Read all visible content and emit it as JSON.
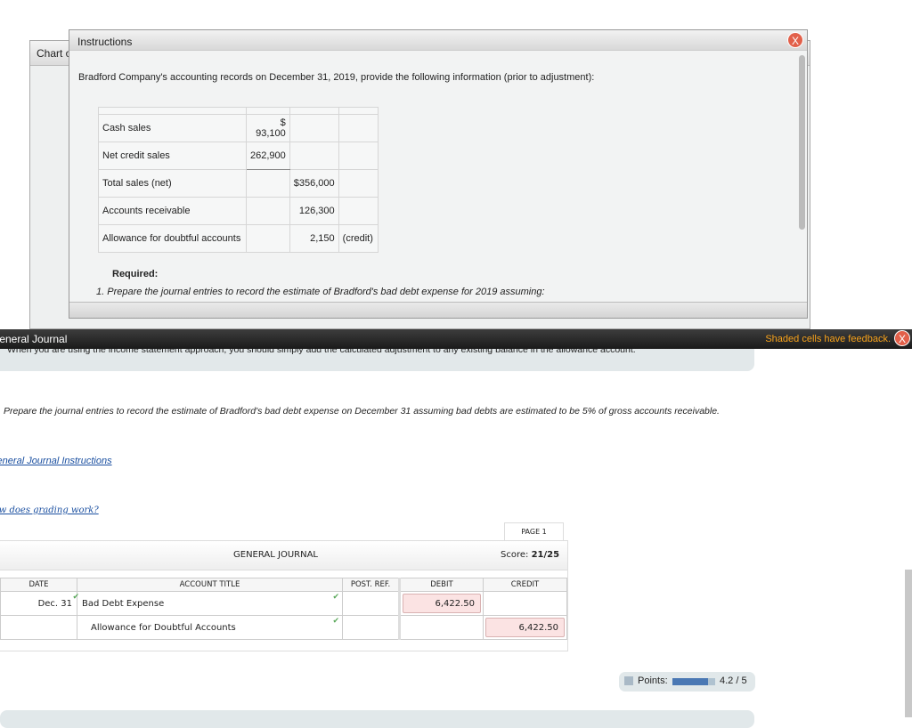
{
  "chart_window": {
    "title": "Chart of Accounts (partial)"
  },
  "instructions": {
    "title": "Instructions",
    "intro": "Bradford Company's accounting records on December 31, 2019, provide the following information (prior to adjustment):",
    "rows": [
      [
        "Cash sales",
        "$ 93,100",
        "",
        ""
      ],
      [
        "Net credit sales",
        "262,900",
        "",
        ""
      ],
      [
        "Total sales (net)",
        "",
        "$356,000",
        ""
      ],
      [
        "Accounts receivable",
        "",
        "126,300",
        ""
      ],
      [
        "Allowance for doubtful accounts",
        "",
        "2,150",
        "(credit)"
      ]
    ],
    "required": "Required:",
    "item1": "1.  Prepare the journal entries to record the estimate of Bradford's bad debt expense for 2019 assuming:"
  },
  "header_bar": {
    "title": "General Journal",
    "feedback": "Shaded cells have feedback."
  },
  "feedback_text": "When you are using the income statement approach, you should simply add the calculated adjustment to any existing balance in the allowance account.",
  "prompt": "Prepare the journal entries to record the estimate of Bradford's bad debt expense on December 31 assuming bad debts are estimated to be 5% of gross accounts receivable.",
  "links": {
    "instructions": "General Journal Instructions",
    "grading": "How does grading work?"
  },
  "journal": {
    "page": "PAGE 1",
    "title": "GENERAL JOURNAL",
    "score_label": "Score:",
    "score": "21/25",
    "columns": [
      "DATE",
      "ACCOUNT TITLE",
      "POST. REF.",
      "DEBIT",
      "CREDIT"
    ],
    "rows": [
      {
        "date": "Dec. 31",
        "account": "Bad Debt Expense",
        "ref": "",
        "debit": "6,422.50",
        "credit": ""
      },
      {
        "date": "",
        "account": "Allowance for Doubtful Accounts",
        "ref": "",
        "debit": "",
        "credit": "6,422.50"
      }
    ]
  },
  "points": {
    "label": "Points:",
    "value": "4.2 / 5",
    "fraction": 0.84
  },
  "colors": {
    "feedback": "#f7a21b",
    "close": "#e2604a",
    "progress": "#4a78b4",
    "shaded": "#fbe3e3"
  }
}
